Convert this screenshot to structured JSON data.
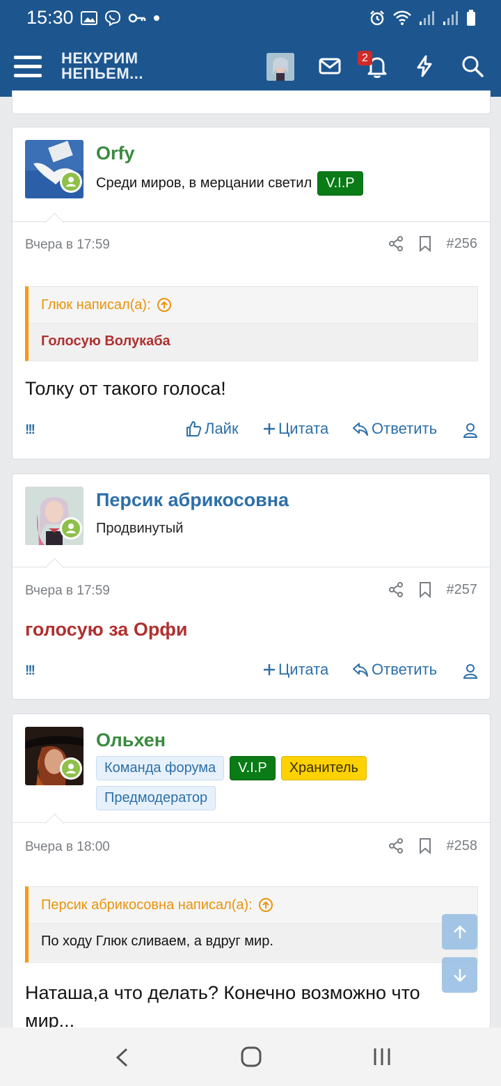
{
  "status_bar": {
    "time": "15:30"
  },
  "header": {
    "logo_line1": "НЕКУРИМ",
    "logo_line2": "НЕПЬЕМ...",
    "notification_count": "2",
    "brand_color": "#1d568f"
  },
  "posts": [
    {
      "username": "Orfy",
      "username_color": "#3a8a3e",
      "user_title": "Среди миров, в мерцании светил",
      "badges": [
        "V.I.P"
      ],
      "time": "Вчера в 17:59",
      "number": "#256",
      "quote_author": "Глюк написал(а):",
      "quote_text": "Голосую Волукаба",
      "message": "Толку от такого голоса!",
      "actions": {
        "marker": "!!!",
        "like": "Лайк",
        "quote": "Цитата",
        "reply": "Ответить"
      }
    },
    {
      "username": "Персик абрикосовна",
      "username_color": "#2d6fa8",
      "user_title": "Продвинутый",
      "time": "Вчера в 17:59",
      "number": "#257",
      "message": "голосую за Орфи",
      "actions": {
        "marker": "!!!",
        "quote": "Цитата",
        "reply": "Ответить"
      }
    },
    {
      "username": "Ольхен",
      "username_color": "#3a8a3e",
      "badges": [
        "Команда форума",
        "V.I.P",
        "Хранитель",
        "Предмодератор"
      ],
      "time": "Вчера в 18:00",
      "number": "#258",
      "quote_author": "Персик абрикосовна написал(а):",
      "quote_text": "По ходу Глюк сливаем, а вдруг мир.",
      "message_line1": "Наташа,а что делать? Конечно возможно что",
      "message_line2": "мир..."
    }
  ],
  "colors": {
    "quote_accent": "#f29a18",
    "link": "#2d6fa8",
    "vip": "#0a7b16",
    "keeper": "#fdd200",
    "highlight_red": "#b03030"
  }
}
